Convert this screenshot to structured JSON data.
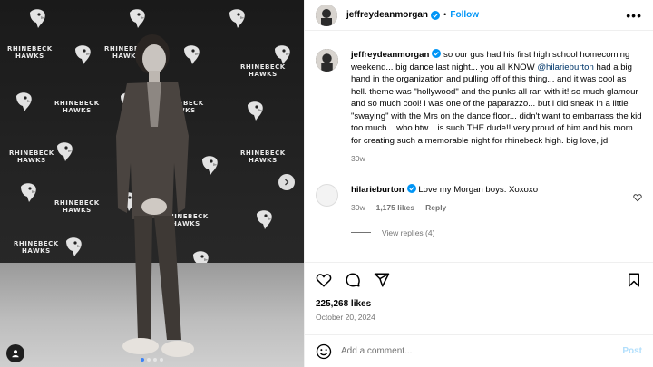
{
  "post": {
    "username": "jeffreydeanmorgan",
    "follow_label": "Follow",
    "more_label": "•••",
    "verified_icon": "verified-badge-icon",
    "accent": "#0095f6"
  },
  "media": {
    "logo_top": "RHINEBECK",
    "logo_bottom": "HAWKS"
  },
  "caption": {
    "username": "jeffreydeanmorgan",
    "text_before": " so our gus had his first high school homecoming weekend... big dance last night... you all KNOW ",
    "mention": "@hilarieburton",
    "text_after": " had a big hand in the organization and pulling off of this thing... and it was cool as hell. theme was \"hollywood\" and the punks all ran with it! so much glamour and so much cool! i was one of the paparazzo... but i did sneak in a little \"swaying\" with the Mrs on the dance floor... didn't want to embarrass the kid too much... who btw... is such THE dude!! very proud of him and his mom for creating such a memorable night for rhinebeck high. big love, jd",
    "age": "30w"
  },
  "reply": {
    "username": "hilarieburton",
    "text": "Love my Morgan boys. Xoxoxo",
    "age": "30w",
    "likes": "1,175 likes",
    "reply_label": "Reply",
    "view_replies": "View replies (4)"
  },
  "actions": {
    "likes": "225,268 likes",
    "date": "October 20, 2024"
  },
  "composer": {
    "placeholder": "Add a comment...",
    "post_label": "Post"
  }
}
